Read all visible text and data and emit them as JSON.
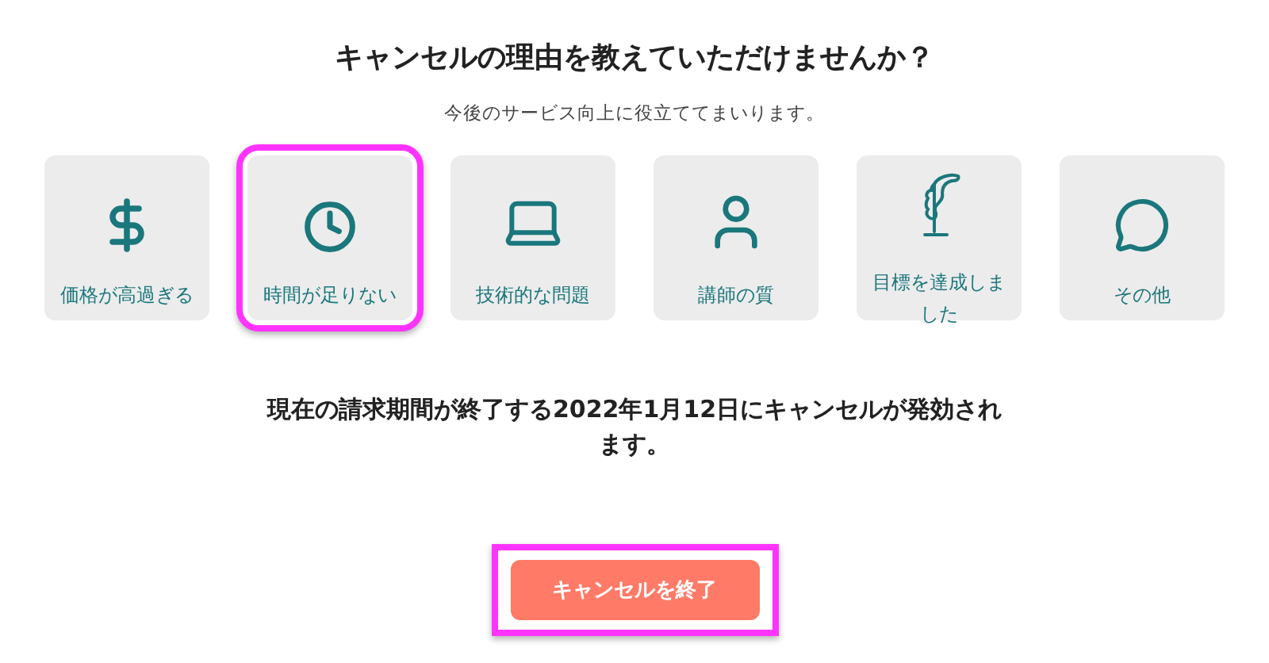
{
  "title": "キャンセルの理由を教えていただけませんか？",
  "subtitle": "今後のサービス向上に役立ててまいります。",
  "reasons": [
    {
      "label": "価格が高過ぎる",
      "selected": false
    },
    {
      "label": "時間が足りない",
      "selected": true
    },
    {
      "label": "技術的な問題",
      "selected": false
    },
    {
      "label": "講師の質",
      "selected": false
    },
    {
      "label": "目標を達成しました",
      "selected": false
    },
    {
      "label": "その他",
      "selected": false
    }
  ],
  "notice": "現在の請求期間が終了する2022年1月12日にキャンセルが発効されます。",
  "button": {
    "label": "キャンセルを終了",
    "highlighted": true
  }
}
